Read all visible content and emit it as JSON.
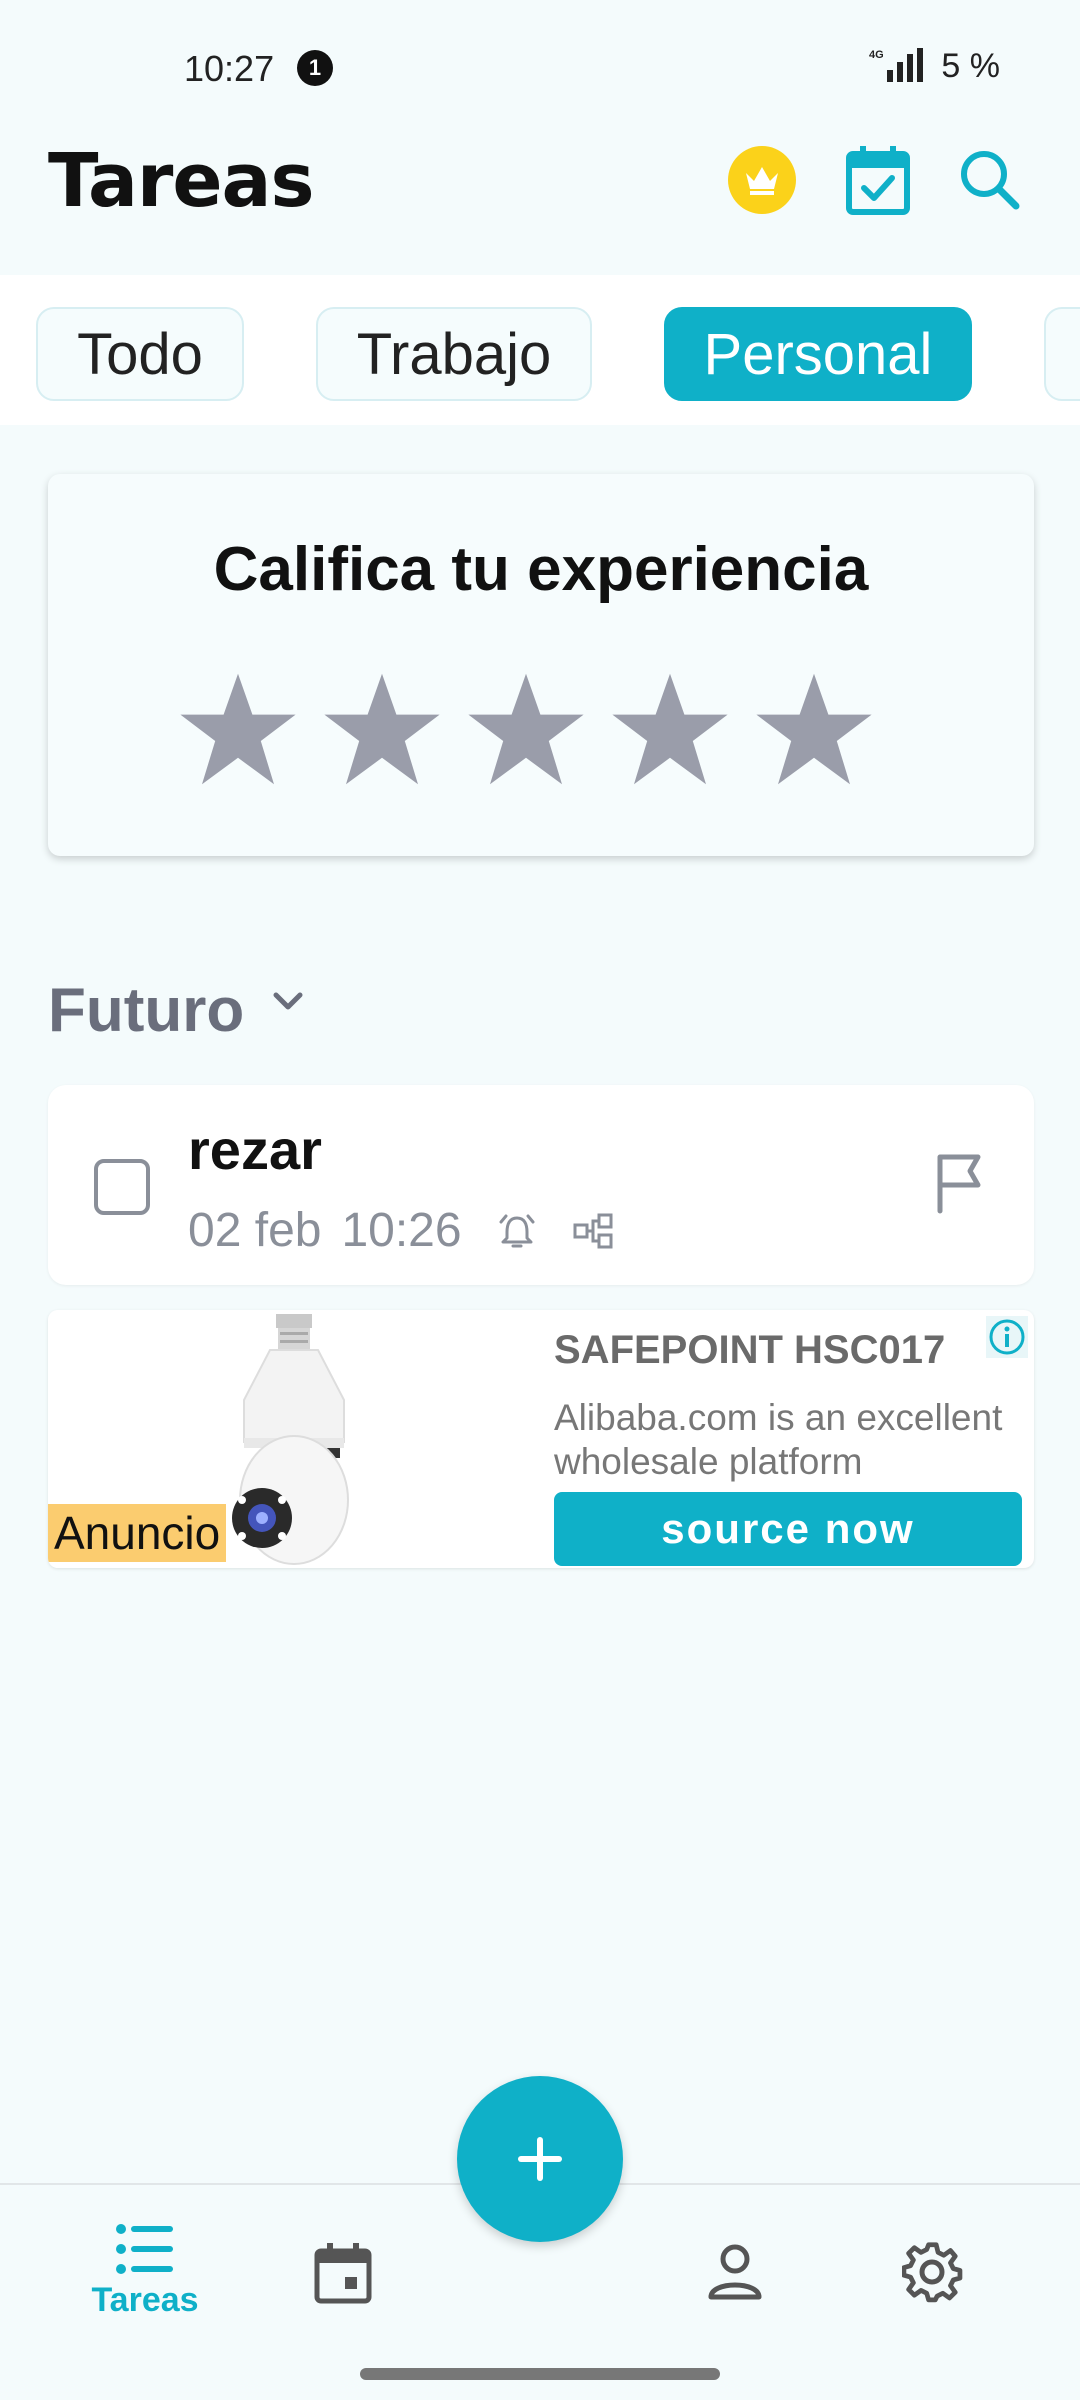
{
  "status_bar": {
    "time": "10:27",
    "notification_count": "1",
    "network": "4G",
    "battery": "5 %"
  },
  "header": {
    "title": "Tareas",
    "icons": [
      "crown-icon",
      "calendar-check-icon",
      "search-icon"
    ]
  },
  "tabs": [
    {
      "label": "Todo",
      "active": false
    },
    {
      "label": "Trabajo",
      "active": false
    },
    {
      "label": "Personal",
      "active": true
    }
  ],
  "rating": {
    "title": "Califica tu experiencia",
    "stars": 5,
    "selected": 0
  },
  "section": {
    "title": "Futuro"
  },
  "task": {
    "title": "rezar",
    "date": "02 feb",
    "time": "10:26",
    "icons": [
      "alarm-icon",
      "subtasks-icon",
      "flag-icon"
    ]
  },
  "ad": {
    "badge": "Anuncio",
    "headline": "SAFEPOINT HSC017",
    "body": "Alibaba.com is an excellent wholesale platform",
    "cta": "source now"
  },
  "bottom_nav": {
    "tareas_label": "Tareas"
  },
  "colors": {
    "accent": "#0fb0c8",
    "crown": "#fbd21a",
    "star_empty": "#9a9daa",
    "background": "#f4fbfc"
  }
}
